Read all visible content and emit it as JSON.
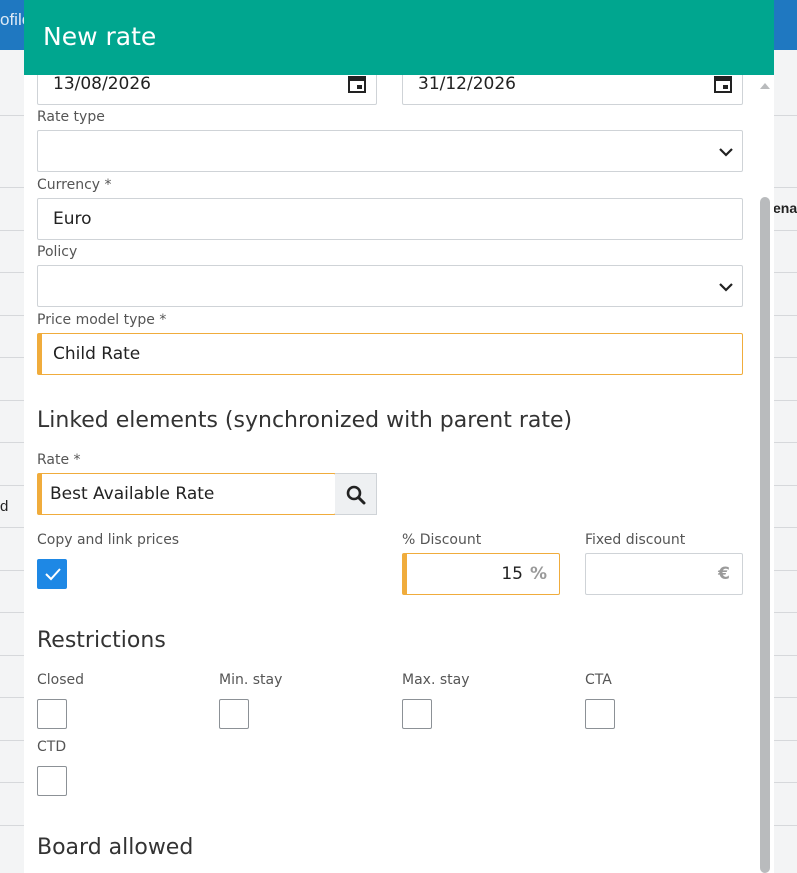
{
  "background": {
    "top_tab_fragment": "ofile",
    "right_column_fragment": "ena",
    "left_row_fragment": "d"
  },
  "dialog": {
    "title": "New rate",
    "start_date": "13/08/2026",
    "end_date": "31/12/2026",
    "rate_type": {
      "label": "Rate type",
      "value": ""
    },
    "currency": {
      "label": "Currency *",
      "value": "Euro"
    },
    "policy": {
      "label": "Policy",
      "value": ""
    },
    "price_model_type": {
      "label": "Price model type *",
      "value": "Child Rate"
    },
    "linked_section_title": "Linked elements (synchronized with parent rate)",
    "rate": {
      "label": "Rate *",
      "value": "Best Available Rate"
    },
    "copy_link_prices": {
      "label": "Copy and link prices",
      "checked": true
    },
    "percent_discount": {
      "label": "% Discount",
      "value": "15",
      "suffix": "%"
    },
    "fixed_discount": {
      "label": "Fixed discount",
      "value": "",
      "suffix": "€"
    },
    "restrictions_title": "Restrictions",
    "restrictions": [
      {
        "label": "Closed"
      },
      {
        "label": "Min. stay"
      },
      {
        "label": "Max. stay"
      },
      {
        "label": "CTA"
      },
      {
        "label": "CTD"
      }
    ],
    "board_title": "Board allowed"
  },
  "colors": {
    "header": "#00a68f",
    "highlight": "#f0ac3c",
    "checkbox_checked": "#1e88e5",
    "topbar": "#1f78c1"
  }
}
